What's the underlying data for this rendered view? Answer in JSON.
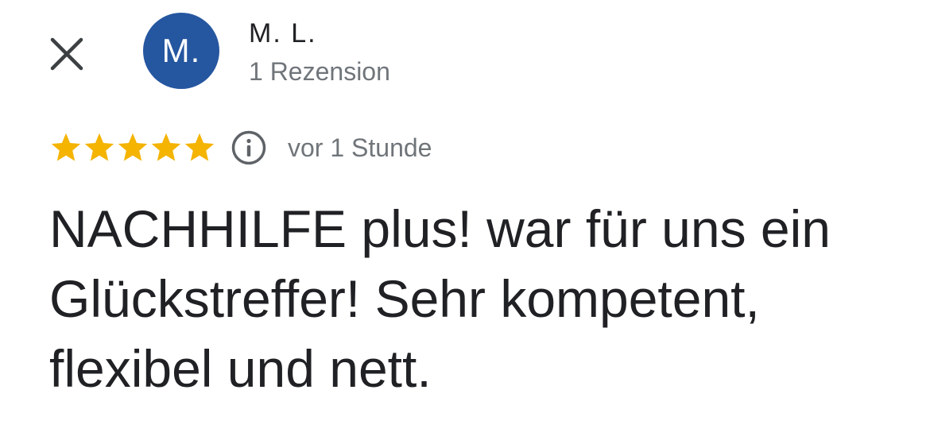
{
  "icons": {
    "close": "close-icon",
    "star": "star-icon",
    "info": "info-icon"
  },
  "colors": {
    "avatar_bg": "#2556a0",
    "star": "#f4b400",
    "primary_text": "#202124",
    "secondary_text": "#70757a"
  },
  "author": {
    "initials": "M.",
    "name": "M. L.",
    "review_count": "1 Rezension"
  },
  "review": {
    "rating": 5,
    "rating_max": 5,
    "time_ago": "vor 1 Stunde",
    "text": "NACHHILFE plus! war für uns ein Glückstreffer! Sehr kompetent, flexibel und nett."
  }
}
